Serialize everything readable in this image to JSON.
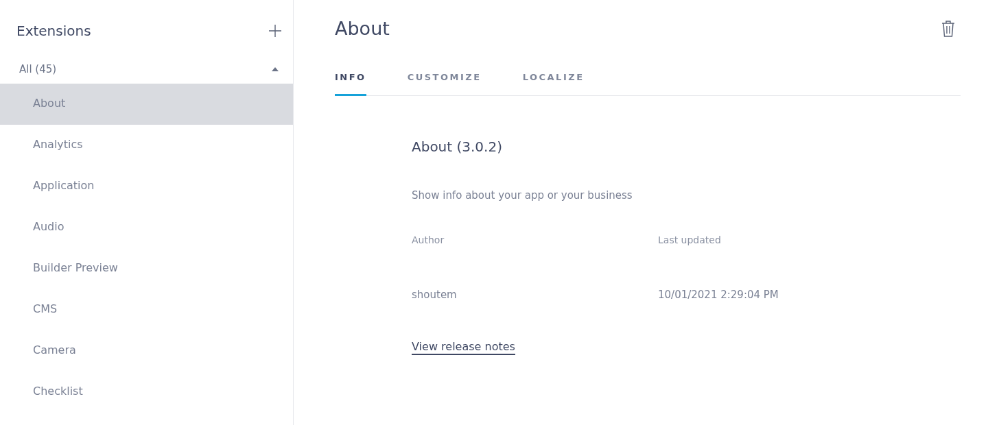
{
  "sidebar": {
    "title": "Extensions",
    "filter": {
      "label": "All (45)",
      "expanded": true
    },
    "items": [
      {
        "label": "About",
        "selected": true
      },
      {
        "label": "Analytics",
        "selected": false
      },
      {
        "label": "Application",
        "selected": false
      },
      {
        "label": "Audio",
        "selected": false
      },
      {
        "label": "Builder Preview",
        "selected": false
      },
      {
        "label": "CMS",
        "selected": false
      },
      {
        "label": "Camera",
        "selected": false
      },
      {
        "label": "Checklist",
        "selected": false
      }
    ]
  },
  "page": {
    "title": "About"
  },
  "tabs": [
    {
      "label": "INFO",
      "selected": true
    },
    {
      "label": "CUSTOMIZE",
      "selected": false
    },
    {
      "label": "LOCALIZE",
      "selected": false
    }
  ],
  "extension": {
    "heading": "About (3.0.2)",
    "description": "Show info about your app or your business",
    "fields": [
      {
        "label": "Author",
        "value": "shoutem"
      },
      {
        "label": "Last updated",
        "value": "10/01/2021 2:29:04 PM"
      }
    ],
    "link": "View release notes"
  }
}
